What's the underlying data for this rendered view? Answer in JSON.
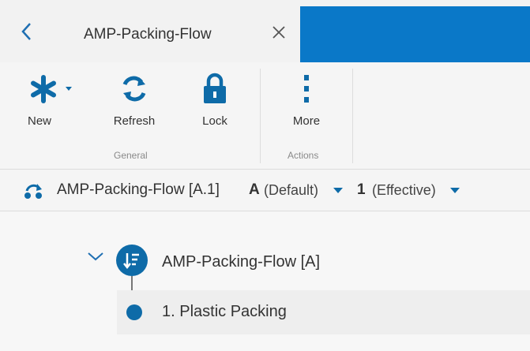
{
  "tab": {
    "title": "AMP-Packing-Flow"
  },
  "toolbar": {
    "groups": [
      {
        "label": "General",
        "buttons": [
          {
            "label": "New",
            "icon": "asterisk-icon"
          },
          {
            "label": "Refresh",
            "icon": "refresh-icon"
          },
          {
            "label": "Lock",
            "icon": "lock-icon"
          }
        ]
      },
      {
        "label": "Actions",
        "buttons": [
          {
            "label": "More",
            "icon": "more-vertical-icon"
          }
        ]
      }
    ]
  },
  "breadcrumb": {
    "name": "AMP-Packing-Flow [A.1]",
    "revision_code": "A",
    "revision_text": "(Default)",
    "version_code": "1",
    "version_text": "(Effective)"
  },
  "tree": {
    "root": {
      "label": "AMP-Packing-Flow [A]"
    },
    "children": [
      {
        "label": "1. Plastic Packing"
      }
    ]
  },
  "colors": {
    "accent_blue": "#0a78c8",
    "icon_blue": "#0e6ba8"
  }
}
